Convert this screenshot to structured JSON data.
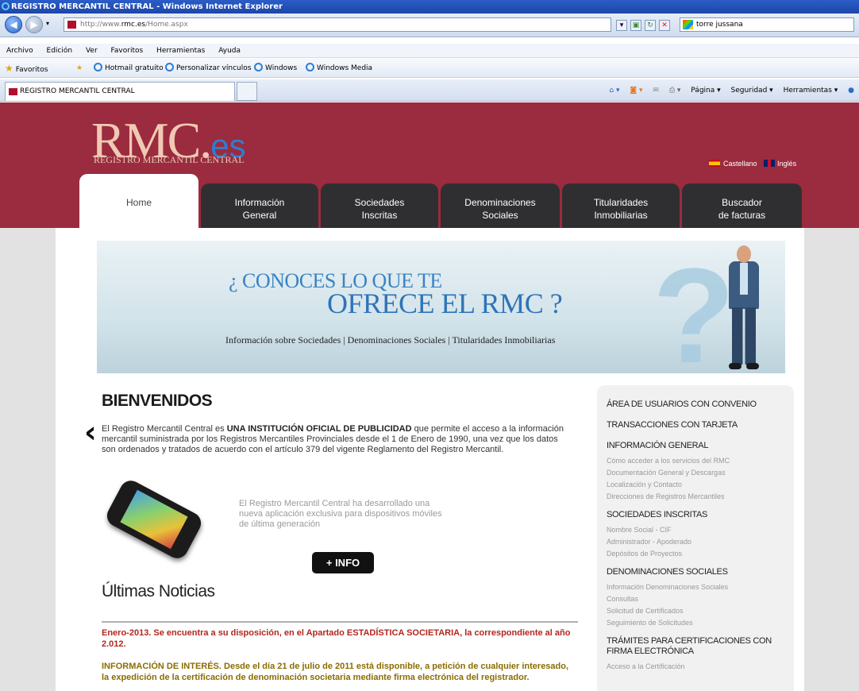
{
  "browser": {
    "title": "REGISTRO MERCANTIL CENTRAL - Windows Internet Explorer",
    "url_prefix": "http://www.",
    "url_domain": "rmc.es",
    "url_path": "/Home.aspx",
    "search_value": "torre jussana",
    "menu": [
      "Archivo",
      "Edición",
      "Ver",
      "Favoritos",
      "Herramientas",
      "Ayuda"
    ],
    "favorites_label": "Favoritos",
    "favorites": [
      "Hotmail gratuito",
      "Personalizar vínculos",
      "Windows",
      "Windows Media"
    ],
    "tab_label": "REGISTRO MERCANTIL CENTRAL",
    "commands": [
      "Página ▾",
      "Seguridad ▾",
      "Herramientas ▾"
    ]
  },
  "site": {
    "logo_main": "RMC",
    "logo_dot": ".",
    "logo_es": "es",
    "logo_sub": "REGISTRO MERCANTIL CENTRAL",
    "lang_es": "Castellano",
    "lang_en": "Inglés",
    "nav": [
      {
        "line1": "Home",
        "line2": ""
      },
      {
        "line1": "Información",
        "line2": "General"
      },
      {
        "line1": "Sociedades",
        "line2": "Inscritas"
      },
      {
        "line1": "Denominaciones",
        "line2": "Sociales"
      },
      {
        "line1": "Titularidades",
        "line2": "Inmobiliarias"
      },
      {
        "line1": "Buscador",
        "line2": "de facturas"
      }
    ]
  },
  "banner": {
    "line1": "¿ CONOCES LO QUE TE",
    "line2": "OFRECE EL RMC ?",
    "sub": "Información sobre Sociedades | Denominaciones Sociales | Titularidades Inmobiliarias",
    "prev": "‹",
    "next": "›"
  },
  "welcome": {
    "title": "BIENVENIDOS",
    "text_before": "El Registro Mercantil Central es ",
    "text_bold": "UNA INSTITUCIÓN OFICIAL DE PUBLICIDAD",
    "text_after": " que permite el acceso a la información mercantil suministrada por los Registros Mercantiles Provinciales desde el 1 de Enero de 1990, una vez que los datos son ordenados y tratados de acuerdo con el artículo 379 del vigente Reglamento del Registro Mercantil.",
    "app_text": "El Registro Mercantil Central ha desarrollado una nueva aplicación exclusiva para dispositivos móviles de última generación",
    "info_button": "+ INFO"
  },
  "news": {
    "title": "Últimas Noticias",
    "items": [
      {
        "text": "Enero-2013. Se encuentra a su disposición, en el Apartado ESTADÍSTICA SOCIETARIA, la correspondiente al año 2.012.",
        "color": "#b3261e"
      },
      {
        "text": "INFORMACIÓN DE INTERÉS. Desde el día 21 de julio de 2011 está disponible, a petición de cualquier interesado, la expedición de la certificación de denominación societaria mediante firma electrónica del registrador.",
        "color": "#8a6d00"
      }
    ]
  },
  "sidebar": {
    "sections": [
      {
        "heading": "ÁREA DE USUARIOS CON CONVENIO",
        "links": []
      },
      {
        "heading": "TRANSACCIONES CON TARJETA",
        "links": []
      },
      {
        "heading": "INFORMACIÓN GENERAL",
        "links": [
          "Cómo acceder a los servicios del RMC",
          "Documentación General y Descargas",
          "Localización y Contacto",
          "Direcciones de Registros Mercantiles"
        ]
      },
      {
        "heading": "SOCIEDADES INSCRITAS",
        "links": [
          "Nombre Social - CIF",
          "Administrador - Apoderado",
          "Depósitos de Proyectos"
        ]
      },
      {
        "heading": "DENOMINACIONES SOCIALES",
        "links": [
          "Información Denominaciones Sociales",
          "Consultas",
          "Solicitud de Certificados",
          "Seguimiento de Solicitudes"
        ]
      },
      {
        "heading": "TRÁMITES PARA CERTIFICACIONES CON FIRMA ELECTRÓNICA",
        "links": [
          "Acceso a la Certificación"
        ]
      }
    ]
  }
}
